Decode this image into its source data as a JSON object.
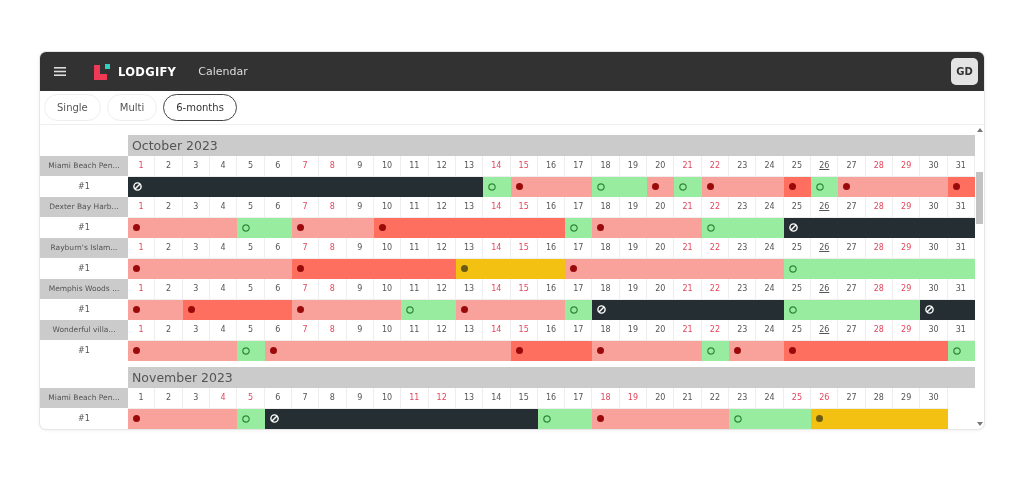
{
  "header": {
    "logo": "LODGIFY",
    "section": "Calendar",
    "avatar": "GD"
  },
  "tabs": [
    {
      "label": "Single",
      "selected": false
    },
    {
      "label": "Multi",
      "selected": false
    },
    {
      "label": "6-months",
      "selected": true
    }
  ],
  "months": [
    {
      "title": "October 2023",
      "properties": [
        {
          "name": "Miami Beach Pen...",
          "unit": "#1",
          "days": [
            {
              "n": "1",
              "weekend": true,
              "today": false,
              "kind": "closed",
              "start": true
            },
            {
              "n": "2",
              "weekend": false,
              "today": false,
              "kind": "closed",
              "start": false
            },
            {
              "n": "3",
              "weekend": false,
              "today": false,
              "kind": "closed",
              "start": false
            },
            {
              "n": "4",
              "weekend": false,
              "today": false,
              "kind": "closed",
              "start": false
            },
            {
              "n": "5",
              "weekend": false,
              "today": false,
              "kind": "closed",
              "start": false
            },
            {
              "n": "6",
              "weekend": false,
              "today": false,
              "kind": "closed",
              "start": false
            },
            {
              "n": "7",
              "weekend": true,
              "today": false,
              "kind": "closed",
              "start": false
            },
            {
              "n": "8",
              "weekend": true,
              "today": false,
              "kind": "closed",
              "start": false
            },
            {
              "n": "9",
              "weekend": false,
              "today": false,
              "kind": "closed",
              "start": false
            },
            {
              "n": "10",
              "weekend": false,
              "today": false,
              "kind": "closed",
              "start": false
            },
            {
              "n": "11",
              "weekend": false,
              "today": false,
              "kind": "closed",
              "start": false
            },
            {
              "n": "12",
              "weekend": false,
              "today": false,
              "kind": "closed",
              "start": false
            },
            {
              "n": "13",
              "weekend": false,
              "today": false,
              "kind": "closed",
              "start": false
            },
            {
              "n": "14",
              "weekend": true,
              "today": false,
              "kind": "available",
              "start": true
            },
            {
              "n": "15",
              "weekend": true,
              "today": false,
              "kind": "booked",
              "start": true
            },
            {
              "n": "16",
              "weekend": false,
              "today": false,
              "kind": "booked",
              "start": false
            },
            {
              "n": "17",
              "weekend": false,
              "today": false,
              "kind": "booked",
              "start": false
            },
            {
              "n": "18",
              "weekend": false,
              "today": false,
              "kind": "available",
              "start": true
            },
            {
              "n": "19",
              "weekend": false,
              "today": false,
              "kind": "available",
              "start": false
            },
            {
              "n": "20",
              "weekend": false,
              "today": false,
              "kind": "booked",
              "start": true
            },
            {
              "n": "21",
              "weekend": true,
              "today": false,
              "kind": "available",
              "start": true
            },
            {
              "n": "22",
              "weekend": true,
              "today": false,
              "kind": "booked",
              "start": true
            },
            {
              "n": "23",
              "weekend": false,
              "today": false,
              "kind": "booked",
              "start": false
            },
            {
              "n": "24",
              "weekend": false,
              "today": false,
              "kind": "booked",
              "start": false
            },
            {
              "n": "25",
              "weekend": false,
              "today": false,
              "kind": "reserved",
              "start": true
            },
            {
              "n": "26",
              "weekend": false,
              "today": true,
              "kind": "available",
              "start": true
            },
            {
              "n": "27",
              "weekend": false,
              "today": false,
              "kind": "booked",
              "start": true
            },
            {
              "n": "28",
              "weekend": true,
              "today": false,
              "kind": "booked",
              "start": false
            },
            {
              "n": "29",
              "weekend": true,
              "today": false,
              "kind": "booked",
              "start": false
            },
            {
              "n": "30",
              "weekend": false,
              "today": false,
              "kind": "booked",
              "start": false
            },
            {
              "n": "31",
              "weekend": false,
              "today": false,
              "kind": "reserved",
              "start": true
            }
          ]
        },
        {
          "name": "Dexter Bay Harb...",
          "unit": "#1",
          "days": [
            {
              "n": "1",
              "weekend": true,
              "today": false,
              "kind": "booked",
              "start": true
            },
            {
              "n": "2",
              "weekend": false,
              "today": false,
              "kind": "booked",
              "start": false
            },
            {
              "n": "3",
              "weekend": false,
              "today": false,
              "kind": "booked",
              "start": false
            },
            {
              "n": "4",
              "weekend": false,
              "today": false,
              "kind": "booked",
              "start": false
            },
            {
              "n": "5",
              "weekend": false,
              "today": false,
              "kind": "available",
              "start": true
            },
            {
              "n": "6",
              "weekend": false,
              "today": false,
              "kind": "available",
              "start": false
            },
            {
              "n": "7",
              "weekend": true,
              "today": false,
              "kind": "booked",
              "start": true
            },
            {
              "n": "8",
              "weekend": true,
              "today": false,
              "kind": "booked",
              "start": false
            },
            {
              "n": "9",
              "weekend": false,
              "today": false,
              "kind": "booked",
              "start": false
            },
            {
              "n": "10",
              "weekend": false,
              "today": false,
              "kind": "reserved",
              "start": true
            },
            {
              "n": "11",
              "weekend": false,
              "today": false,
              "kind": "reserved",
              "start": false
            },
            {
              "n": "12",
              "weekend": false,
              "today": false,
              "kind": "reserved",
              "start": false
            },
            {
              "n": "13",
              "weekend": false,
              "today": false,
              "kind": "reserved",
              "start": false
            },
            {
              "n": "14",
              "weekend": true,
              "today": false,
              "kind": "reserved",
              "start": false
            },
            {
              "n": "15",
              "weekend": true,
              "today": false,
              "kind": "reserved",
              "start": false
            },
            {
              "n": "16",
              "weekend": false,
              "today": false,
              "kind": "reserved",
              "start": false
            },
            {
              "n": "17",
              "weekend": false,
              "today": false,
              "kind": "available",
              "start": true
            },
            {
              "n": "18",
              "weekend": false,
              "today": false,
              "kind": "booked",
              "start": true
            },
            {
              "n": "19",
              "weekend": false,
              "today": false,
              "kind": "booked",
              "start": false
            },
            {
              "n": "20",
              "weekend": false,
              "today": false,
              "kind": "booked",
              "start": false
            },
            {
              "n": "21",
              "weekend": true,
              "today": false,
              "kind": "booked",
              "start": false
            },
            {
              "n": "22",
              "weekend": true,
              "today": false,
              "kind": "available",
              "start": true
            },
            {
              "n": "23",
              "weekend": false,
              "today": false,
              "kind": "available",
              "start": false
            },
            {
              "n": "24",
              "weekend": false,
              "today": false,
              "kind": "available",
              "start": false
            },
            {
              "n": "25",
              "weekend": false,
              "today": false,
              "kind": "closed",
              "start": true
            },
            {
              "n": "26",
              "weekend": false,
              "today": true,
              "kind": "closed",
              "start": false
            },
            {
              "n": "27",
              "weekend": false,
              "today": false,
              "kind": "closed",
              "start": false
            },
            {
              "n": "28",
              "weekend": true,
              "today": false,
              "kind": "closed",
              "start": false
            },
            {
              "n": "29",
              "weekend": true,
              "today": false,
              "kind": "closed",
              "start": false
            },
            {
              "n": "30",
              "weekend": false,
              "today": false,
              "kind": "closed",
              "start": false
            },
            {
              "n": "31",
              "weekend": false,
              "today": false,
              "kind": "closed",
              "start": false
            }
          ]
        },
        {
          "name": "Rayburn's Islam...",
          "unit": "#1",
          "days": [
            {
              "n": "1",
              "weekend": true,
              "today": false,
              "kind": "booked",
              "start": true
            },
            {
              "n": "2",
              "weekend": false,
              "today": false,
              "kind": "booked",
              "start": false
            },
            {
              "n": "3",
              "weekend": false,
              "today": false,
              "kind": "booked",
              "start": false
            },
            {
              "n": "4",
              "weekend": false,
              "today": false,
              "kind": "booked",
              "start": false
            },
            {
              "n": "5",
              "weekend": false,
              "today": false,
              "kind": "booked",
              "start": false
            },
            {
              "n": "6",
              "weekend": false,
              "today": false,
              "kind": "booked",
              "start": false
            },
            {
              "n": "7",
              "weekend": true,
              "today": false,
              "kind": "reserved",
              "start": true
            },
            {
              "n": "8",
              "weekend": true,
              "today": false,
              "kind": "reserved",
              "start": false
            },
            {
              "n": "9",
              "weekend": false,
              "today": false,
              "kind": "reserved",
              "start": false
            },
            {
              "n": "10",
              "weekend": false,
              "today": false,
              "kind": "reserved",
              "start": false
            },
            {
              "n": "11",
              "weekend": false,
              "today": false,
              "kind": "reserved",
              "start": false
            },
            {
              "n": "12",
              "weekend": false,
              "today": false,
              "kind": "reserved",
              "start": false
            },
            {
              "n": "13",
              "weekend": false,
              "today": false,
              "kind": "pending",
              "start": true
            },
            {
              "n": "14",
              "weekend": true,
              "today": false,
              "kind": "pending",
              "start": false
            },
            {
              "n": "15",
              "weekend": true,
              "today": false,
              "kind": "pending",
              "start": false
            },
            {
              "n": "16",
              "weekend": false,
              "today": false,
              "kind": "pending",
              "start": false
            },
            {
              "n": "17",
              "weekend": false,
              "today": false,
              "kind": "booked",
              "start": true
            },
            {
              "n": "18",
              "weekend": false,
              "today": false,
              "kind": "booked",
              "start": false
            },
            {
              "n": "19",
              "weekend": false,
              "today": false,
              "kind": "booked",
              "start": false
            },
            {
              "n": "20",
              "weekend": false,
              "today": false,
              "kind": "booked",
              "start": false
            },
            {
              "n": "21",
              "weekend": true,
              "today": false,
              "kind": "booked",
              "start": false
            },
            {
              "n": "22",
              "weekend": true,
              "today": false,
              "kind": "booked",
              "start": false
            },
            {
              "n": "23",
              "weekend": false,
              "today": false,
              "kind": "booked",
              "start": false
            },
            {
              "n": "24",
              "weekend": false,
              "today": false,
              "kind": "booked",
              "start": false
            },
            {
              "n": "25",
              "weekend": false,
              "today": false,
              "kind": "available",
              "start": true
            },
            {
              "n": "26",
              "weekend": false,
              "today": true,
              "kind": "available",
              "start": false
            },
            {
              "n": "27",
              "weekend": false,
              "today": false,
              "kind": "available",
              "start": false
            },
            {
              "n": "28",
              "weekend": true,
              "today": false,
              "kind": "available",
              "start": false
            },
            {
              "n": "29",
              "weekend": true,
              "today": false,
              "kind": "available",
              "start": false
            },
            {
              "n": "30",
              "weekend": false,
              "today": false,
              "kind": "available",
              "start": false
            },
            {
              "n": "31",
              "weekend": false,
              "today": false,
              "kind": "available",
              "start": false
            }
          ]
        },
        {
          "name": "Memphis Woods ...",
          "unit": "#1",
          "days": [
            {
              "n": "1",
              "weekend": true,
              "today": false,
              "kind": "booked",
              "start": true
            },
            {
              "n": "2",
              "weekend": false,
              "today": false,
              "kind": "booked",
              "start": false
            },
            {
              "n": "3",
              "weekend": false,
              "today": false,
              "kind": "reserved",
              "start": true
            },
            {
              "n": "4",
              "weekend": false,
              "today": false,
              "kind": "reserved",
              "start": false
            },
            {
              "n": "5",
              "weekend": false,
              "today": false,
              "kind": "reserved",
              "start": false
            },
            {
              "n": "6",
              "weekend": false,
              "today": false,
              "kind": "reserved",
              "start": false
            },
            {
              "n": "7",
              "weekend": true,
              "today": false,
              "kind": "booked",
              "start": true
            },
            {
              "n": "8",
              "weekend": true,
              "today": false,
              "kind": "booked",
              "start": false
            },
            {
              "n": "9",
              "weekend": false,
              "today": false,
              "kind": "booked",
              "start": false
            },
            {
              "n": "10",
              "weekend": false,
              "today": false,
              "kind": "booked",
              "start": false
            },
            {
              "n": "11",
              "weekend": false,
              "today": false,
              "kind": "available",
              "start": true
            },
            {
              "n": "12",
              "weekend": false,
              "today": false,
              "kind": "available",
              "start": false
            },
            {
              "n": "13",
              "weekend": false,
              "today": false,
              "kind": "booked",
              "start": true
            },
            {
              "n": "14",
              "weekend": true,
              "today": false,
              "kind": "booked",
              "start": false
            },
            {
              "n": "15",
              "weekend": true,
              "today": false,
              "kind": "booked",
              "start": false
            },
            {
              "n": "16",
              "weekend": false,
              "today": false,
              "kind": "booked",
              "start": false
            },
            {
              "n": "17",
              "weekend": false,
              "today": false,
              "kind": "available",
              "start": true
            },
            {
              "n": "18",
              "weekend": false,
              "today": false,
              "kind": "closed",
              "start": true
            },
            {
              "n": "19",
              "weekend": false,
              "today": false,
              "kind": "closed",
              "start": false
            },
            {
              "n": "20",
              "weekend": false,
              "today": false,
              "kind": "closed",
              "start": false
            },
            {
              "n": "21",
              "weekend": true,
              "today": false,
              "kind": "closed",
              "start": false
            },
            {
              "n": "22",
              "weekend": true,
              "today": false,
              "kind": "closed",
              "start": false
            },
            {
              "n": "23",
              "weekend": false,
              "today": false,
              "kind": "closed",
              "start": false
            },
            {
              "n": "24",
              "weekend": false,
              "today": false,
              "kind": "closed",
              "start": false
            },
            {
              "n": "25",
              "weekend": false,
              "today": false,
              "kind": "available",
              "start": true
            },
            {
              "n": "26",
              "weekend": false,
              "today": true,
              "kind": "available",
              "start": false
            },
            {
              "n": "27",
              "weekend": false,
              "today": false,
              "kind": "available",
              "start": false
            },
            {
              "n": "28",
              "weekend": true,
              "today": false,
              "kind": "available",
              "start": false
            },
            {
              "n": "29",
              "weekend": true,
              "today": false,
              "kind": "available",
              "start": false
            },
            {
              "n": "30",
              "weekend": false,
              "today": false,
              "kind": "closed",
              "start": true
            },
            {
              "n": "31",
              "weekend": false,
              "today": false,
              "kind": "closed",
              "start": false
            }
          ]
        },
        {
          "name": "Wonderful villa...",
          "unit": "#1",
          "days": [
            {
              "n": "1",
              "weekend": true,
              "today": false,
              "kind": "booked",
              "start": true
            },
            {
              "n": "2",
              "weekend": false,
              "today": false,
              "kind": "booked",
              "start": false
            },
            {
              "n": "3",
              "weekend": false,
              "today": false,
              "kind": "booked",
              "start": false
            },
            {
              "n": "4",
              "weekend": false,
              "today": false,
              "kind": "booked",
              "start": false
            },
            {
              "n": "5",
              "weekend": false,
              "today": false,
              "kind": "available",
              "start": true
            },
            {
              "n": "6",
              "weekend": false,
              "today": false,
              "kind": "booked",
              "start": true
            },
            {
              "n": "7",
              "weekend": true,
              "today": false,
              "kind": "booked",
              "start": false
            },
            {
              "n": "8",
              "weekend": true,
              "today": false,
              "kind": "booked",
              "start": false
            },
            {
              "n": "9",
              "weekend": false,
              "today": false,
              "kind": "booked",
              "start": false
            },
            {
              "n": "10",
              "weekend": false,
              "today": false,
              "kind": "booked",
              "start": false
            },
            {
              "n": "11",
              "weekend": false,
              "today": false,
              "kind": "booked",
              "start": false
            },
            {
              "n": "12",
              "weekend": false,
              "today": false,
              "kind": "booked",
              "start": false
            },
            {
              "n": "13",
              "weekend": false,
              "today": false,
              "kind": "booked",
              "start": false
            },
            {
              "n": "14",
              "weekend": true,
              "today": false,
              "kind": "booked",
              "start": false
            },
            {
              "n": "15",
              "weekend": true,
              "today": false,
              "kind": "reserved",
              "start": true
            },
            {
              "n": "16",
              "weekend": false,
              "today": false,
              "kind": "reserved",
              "start": false
            },
            {
              "n": "17",
              "weekend": false,
              "today": false,
              "kind": "reserved",
              "start": false
            },
            {
              "n": "18",
              "weekend": false,
              "today": false,
              "kind": "booked",
              "start": true
            },
            {
              "n": "19",
              "weekend": false,
              "today": false,
              "kind": "booked",
              "start": false
            },
            {
              "n": "20",
              "weekend": false,
              "today": false,
              "kind": "booked",
              "start": false
            },
            {
              "n": "21",
              "weekend": true,
              "today": false,
              "kind": "booked",
              "start": false
            },
            {
              "n": "22",
              "weekend": true,
              "today": false,
              "kind": "available",
              "start": true
            },
            {
              "n": "23",
              "weekend": false,
              "today": false,
              "kind": "booked",
              "start": true
            },
            {
              "n": "24",
              "weekend": false,
              "today": false,
              "kind": "booked",
              "start": false
            },
            {
              "n": "25",
              "weekend": false,
              "today": false,
              "kind": "reserved",
              "start": true
            },
            {
              "n": "26",
              "weekend": false,
              "today": true,
              "kind": "reserved",
              "start": false
            },
            {
              "n": "27",
              "weekend": false,
              "today": false,
              "kind": "reserved",
              "start": false
            },
            {
              "n": "28",
              "weekend": true,
              "today": false,
              "kind": "reserved",
              "start": false
            },
            {
              "n": "29",
              "weekend": true,
              "today": false,
              "kind": "reserved",
              "start": false
            },
            {
              "n": "30",
              "weekend": false,
              "today": false,
              "kind": "reserved",
              "start": false
            },
            {
              "n": "31",
              "weekend": false,
              "today": false,
              "kind": "available",
              "start": true
            }
          ]
        }
      ]
    },
    {
      "title": "November 2023",
      "properties": [
        {
          "name": "Miami Beach Pen...",
          "unit": "#1",
          "days": [
            {
              "n": "1",
              "weekend": false,
              "today": false,
              "kind": "booked",
              "start": true
            },
            {
              "n": "2",
              "weekend": false,
              "today": false,
              "kind": "booked",
              "start": false
            },
            {
              "n": "3",
              "weekend": false,
              "today": false,
              "kind": "booked",
              "start": false
            },
            {
              "n": "4",
              "weekend": true,
              "today": false,
              "kind": "booked",
              "start": false
            },
            {
              "n": "5",
              "weekend": true,
              "today": false,
              "kind": "available",
              "start": true
            },
            {
              "n": "6",
              "weekend": false,
              "today": false,
              "kind": "closed",
              "start": true
            },
            {
              "n": "7",
              "weekend": false,
              "today": false,
              "kind": "closed",
              "start": false
            },
            {
              "n": "8",
              "weekend": false,
              "today": false,
              "kind": "closed",
              "start": false
            },
            {
              "n": "9",
              "weekend": false,
              "today": false,
              "kind": "closed",
              "start": false
            },
            {
              "n": "10",
              "weekend": false,
              "today": false,
              "kind": "closed",
              "start": false
            },
            {
              "n": "11",
              "weekend": true,
              "today": false,
              "kind": "closed",
              "start": false
            },
            {
              "n": "12",
              "weekend": true,
              "today": false,
              "kind": "closed",
              "start": false
            },
            {
              "n": "13",
              "weekend": false,
              "today": false,
              "kind": "closed",
              "start": false
            },
            {
              "n": "14",
              "weekend": false,
              "today": false,
              "kind": "closed",
              "start": false
            },
            {
              "n": "15",
              "weekend": false,
              "today": false,
              "kind": "closed",
              "start": false
            },
            {
              "n": "16",
              "weekend": false,
              "today": false,
              "kind": "available",
              "start": true
            },
            {
              "n": "17",
              "weekend": false,
              "today": false,
              "kind": "available",
              "start": false
            },
            {
              "n": "18",
              "weekend": true,
              "today": false,
              "kind": "booked",
              "start": true
            },
            {
              "n": "19",
              "weekend": true,
              "today": false,
              "kind": "booked",
              "start": false
            },
            {
              "n": "20",
              "weekend": false,
              "today": false,
              "kind": "booked",
              "start": false
            },
            {
              "n": "21",
              "weekend": false,
              "today": false,
              "kind": "booked",
              "start": false
            },
            {
              "n": "22",
              "weekend": false,
              "today": false,
              "kind": "booked",
              "start": false
            },
            {
              "n": "23",
              "weekend": false,
              "today": false,
              "kind": "available",
              "start": true
            },
            {
              "n": "24",
              "weekend": false,
              "today": false,
              "kind": "available",
              "start": false
            },
            {
              "n": "25",
              "weekend": true,
              "today": false,
              "kind": "available",
              "start": false
            },
            {
              "n": "26",
              "weekend": true,
              "today": false,
              "kind": "pending",
              "start": true
            },
            {
              "n": "27",
              "weekend": false,
              "today": false,
              "kind": "pending",
              "start": false
            },
            {
              "n": "28",
              "weekend": false,
              "today": false,
              "kind": "pending",
              "start": false
            },
            {
              "n": "29",
              "weekend": false,
              "today": false,
              "kind": "pending",
              "start": false
            },
            {
              "n": "30",
              "weekend": false,
              "today": false,
              "kind": "pending",
              "start": false
            }
          ]
        }
      ]
    }
  ]
}
